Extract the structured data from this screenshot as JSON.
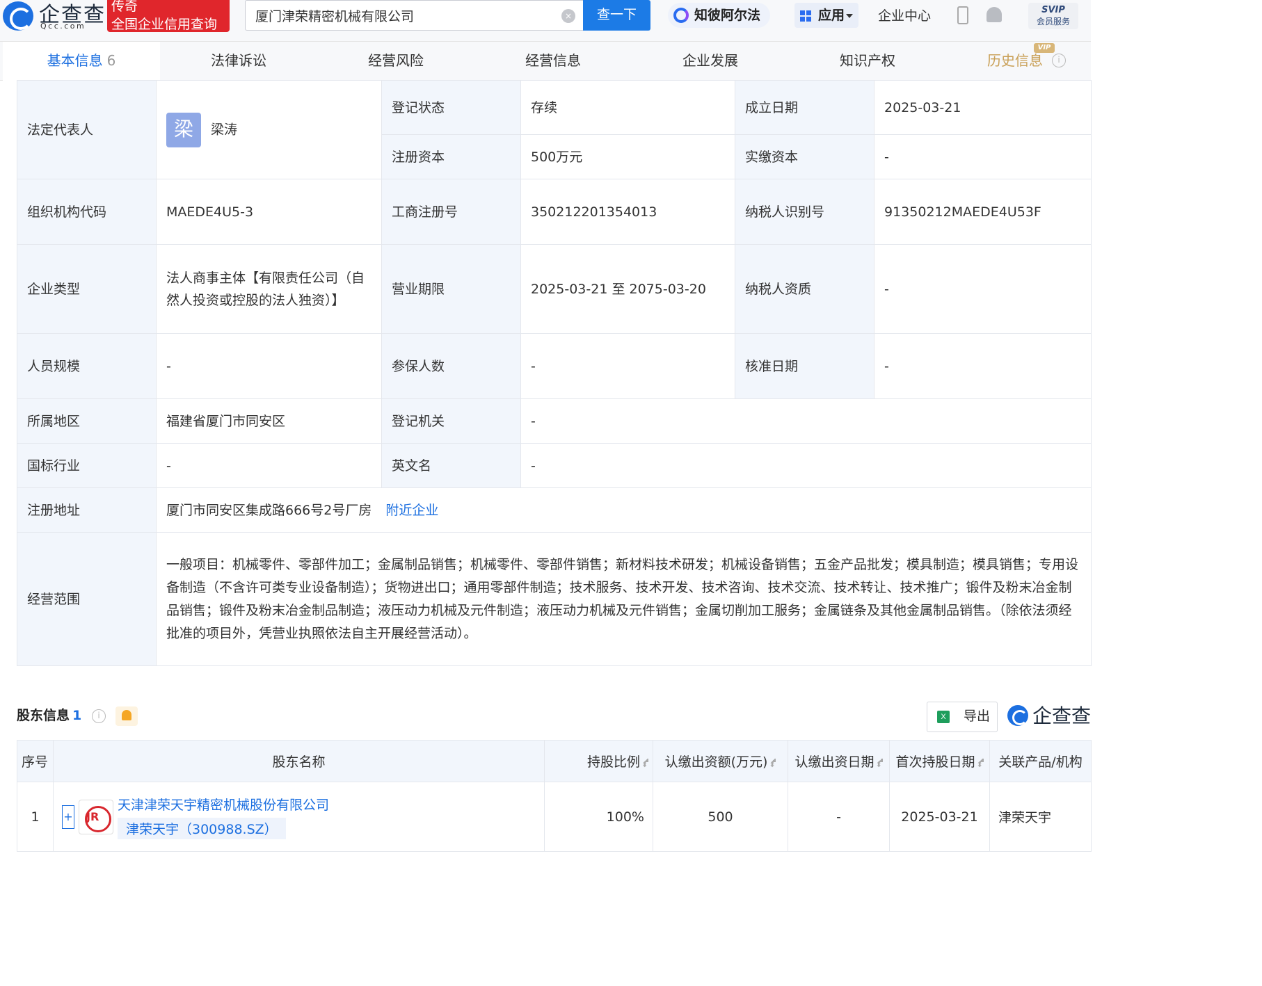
{
  "header": {
    "logo_name": "企查查",
    "logo_url": "Qcc.com",
    "tag_line1": "传奇",
    "tag_line2": "全国企业信用查询",
    "search_value": "厦门津荣精密机械有限公司",
    "search_button": "查一下",
    "zhibi_label": "知彼阿尔法",
    "apps_label": "应用",
    "enterprise_center": "企业中心",
    "svip_top": "SVIP",
    "svip_bottom": "会员服务"
  },
  "tabs": [
    {
      "label": "基本信息",
      "count": "6"
    },
    {
      "label": "法律诉讼"
    },
    {
      "label": "经营风险"
    },
    {
      "label": "经营信息"
    },
    {
      "label": "企业发展"
    },
    {
      "label": "知识产权"
    },
    {
      "label": "历史信息",
      "badge": "VIP"
    }
  ],
  "info": {
    "legal_rep_label": "法定代表人",
    "legal_rep_avatar": "梁",
    "legal_rep_name": "梁涛",
    "reg_status_label": "登记状态",
    "reg_status_value": "存续",
    "found_date_label": "成立日期",
    "found_date_value": "2025-03-21",
    "reg_capital_label": "注册资本",
    "reg_capital_value": "500万元",
    "paid_capital_label": "实缴资本",
    "paid_capital_value": "-",
    "org_code_label": "组织机构代码",
    "org_code_value": "MAEDE4U5-3",
    "biz_reg_no_label": "工商注册号",
    "biz_reg_no_value": "350212201354013",
    "taxpayer_id_label": "纳税人识别号",
    "taxpayer_id_value": "91350212MAEDE4U53F",
    "company_type_label": "企业类型",
    "company_type_value": "法人商事主体【有限责任公司（自然人投资或控股的法人独资）】",
    "biz_term_label": "营业期限",
    "biz_term_value": "2025-03-21 至 2075-03-20",
    "taxpayer_qual_label": "纳税人资质",
    "taxpayer_qual_value": "-",
    "staff_size_label": "人员规模",
    "staff_size_value": "-",
    "insured_label": "参保人数",
    "insured_value": "-",
    "approval_date_label": "核准日期",
    "approval_date_value": "-",
    "region_label": "所属地区",
    "region_value": "福建省厦门市同安区",
    "reg_authority_label": "登记机关",
    "reg_authority_value": "-",
    "industry_label": "国标行业",
    "industry_value": "-",
    "english_name_label": "英文名",
    "english_name_value": "-",
    "address_label": "注册地址",
    "address_value": "厦门市同安区集成路666号2号厂房",
    "nearby_link": "附近企业",
    "scope_label": "经营范围",
    "scope_value": "一般项目：机械零件、零部件加工；金属制品销售；机械零件、零部件销售；新材料技术研发；机械设备销售；五金产品批发；模具制造；模具销售；专用设备制造（不含许可类专业设备制造）；货物进出口；通用零部件制造；技术服务、技术开发、技术咨询、技术交流、技术转让、技术推广；锻件及粉末冶金制品销售；锻件及粉末冶金制品制造；液压动力机械及元件制造；液压动力机械及元件销售；金属切削加工服务；金属链条及其他金属制品销售。（除依法须经批准的项目外，凭营业执照依法自主开展经营活动）。"
  },
  "shareholders": {
    "title": "股东信息",
    "count": "1",
    "export_label": "导出",
    "brand": "企查查",
    "columns": [
      "序号",
      "股东名称",
      "持股比例",
      "认缴出资额(万元)",
      "认缴出资日期",
      "首次持股日期",
      "关联产品/机构"
    ],
    "rows": [
      {
        "index": "1",
        "logo_text": "JR",
        "name": "天津津荣天宇精密机械股份有限公司",
        "stock": "津荣天宇（300988.SZ）",
        "ratio": "100%",
        "amount": "500",
        "subscribe_date": "-",
        "first_hold_date": "2025-03-21",
        "related": "津荣天宇"
      }
    ]
  }
}
